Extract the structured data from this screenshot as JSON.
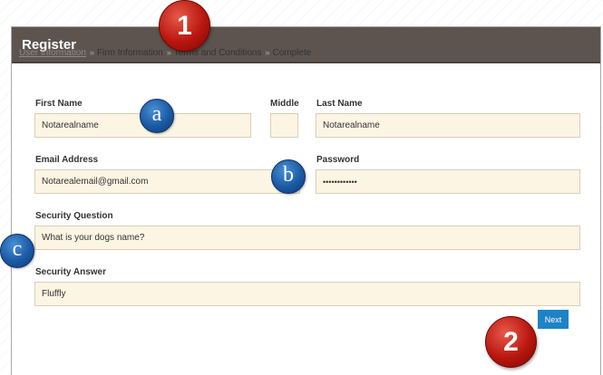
{
  "header": {
    "title": "Register"
  },
  "breadcrumb": {
    "separator": "»",
    "steps": [
      "User Information",
      "Firm Information",
      "Terms and Conditions",
      "Complete"
    ]
  },
  "form": {
    "first_name": {
      "label": "First Name",
      "value": "Notarealname"
    },
    "middle": {
      "label": "Middle",
      "value": ""
    },
    "last_name": {
      "label": "Last Name",
      "value": "Notarealname"
    },
    "email": {
      "label": "Email Address",
      "value": "Notarealemail@gmail.com"
    },
    "password": {
      "label": "Password",
      "value": "••••••••••••"
    },
    "security_question": {
      "label": "Security Question",
      "value": "What is your dogs name?"
    },
    "security_answer": {
      "label": "Security Answer",
      "value": "Fluffly"
    },
    "next_label": "Next"
  },
  "markers": {
    "step1": "1",
    "step2": "2",
    "a": "a",
    "b": "b",
    "c": "c"
  },
  "colors": {
    "header": "#5d5450",
    "field_bg": "#fcf5e4",
    "button": "#1d83c6",
    "marker_red": "#b8160f",
    "marker_blue": "#1a5aa4"
  }
}
